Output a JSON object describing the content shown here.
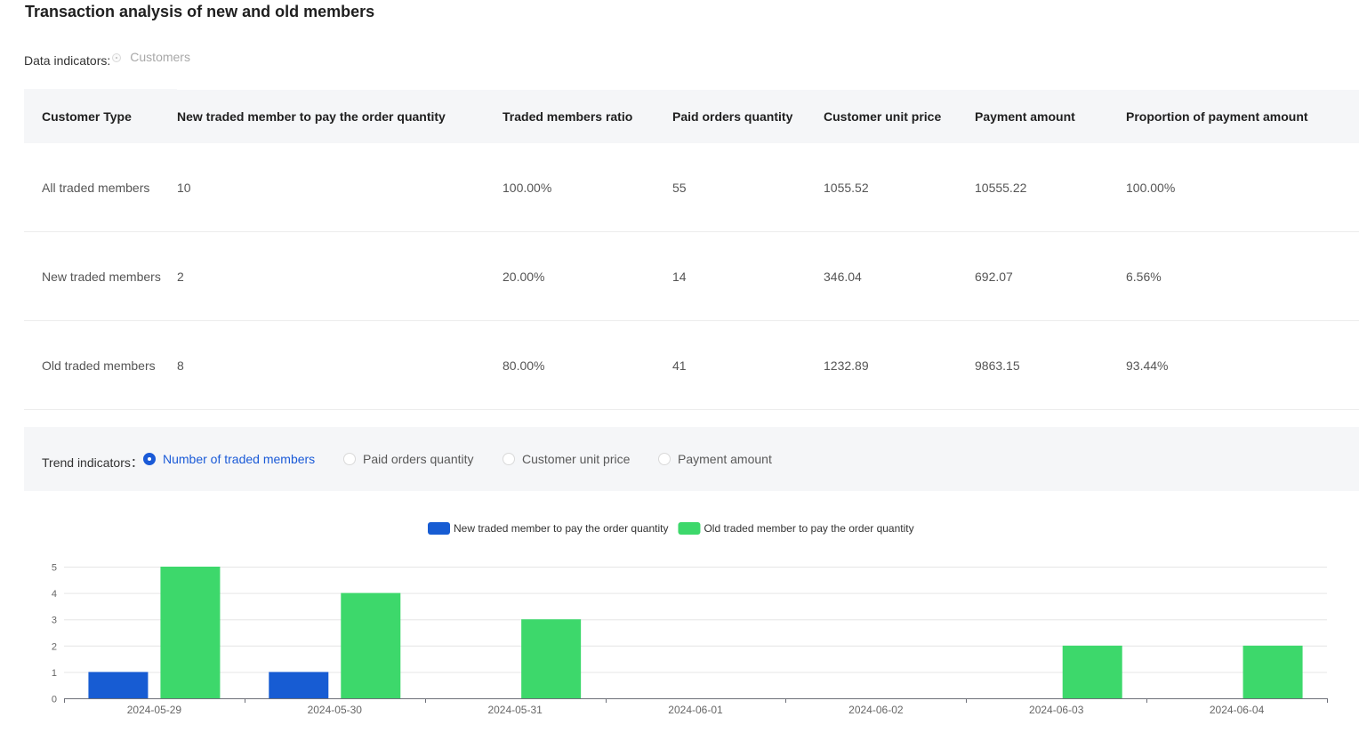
{
  "page": {
    "title": "Transaction analysis of new and old members"
  },
  "data_indicators": {
    "label": "Data indicators:",
    "option": "Customers"
  },
  "table": {
    "headers": [
      "Customer Type",
      "New traded member to pay the order quantity",
      "Traded members ratio",
      "Paid orders quantity",
      "Customer unit price",
      "Payment amount",
      "Proportion of payment amount"
    ],
    "rows": [
      [
        "All traded members",
        "10",
        "100.00%",
        "55",
        "1055.52",
        "10555.22",
        "100.00%"
      ],
      [
        "New traded members",
        "2",
        "20.00%",
        "14",
        "346.04",
        "692.07",
        "6.56%"
      ],
      [
        "Old traded members",
        "8",
        "80.00%",
        "41",
        "1232.89",
        "9863.15",
        "93.44%"
      ]
    ]
  },
  "trend": {
    "label": "Trend indicators：",
    "options": [
      {
        "label": "Number of traded members",
        "selected": true
      },
      {
        "label": "Paid orders quantity",
        "selected": false
      },
      {
        "label": "Customer unit price",
        "selected": false
      },
      {
        "label": "Payment amount",
        "selected": false
      }
    ]
  },
  "colors": {
    "accent": "#1a5ad7",
    "new_series": "#175cd3",
    "old_series": "#3dd86b"
  },
  "chart_data": {
    "type": "bar",
    "categories": [
      "2024-05-29",
      "2024-05-30",
      "2024-05-31",
      "2024-06-01",
      "2024-06-02",
      "2024-06-03",
      "2024-06-04"
    ],
    "series": [
      {
        "name": "New traded member to pay the order quantity",
        "values": [
          1,
          1,
          0,
          0,
          0,
          0,
          0
        ],
        "color": "#175cd3"
      },
      {
        "name": "Old traded member to pay the order quantity",
        "values": [
          5,
          4,
          3,
          0,
          0,
          2,
          2
        ],
        "color": "#3dd86b"
      }
    ],
    "yticks": [
      0,
      1,
      2,
      3,
      4,
      5
    ],
    "ylim": [
      0,
      5
    ],
    "grid": true,
    "legend": "top-center"
  }
}
